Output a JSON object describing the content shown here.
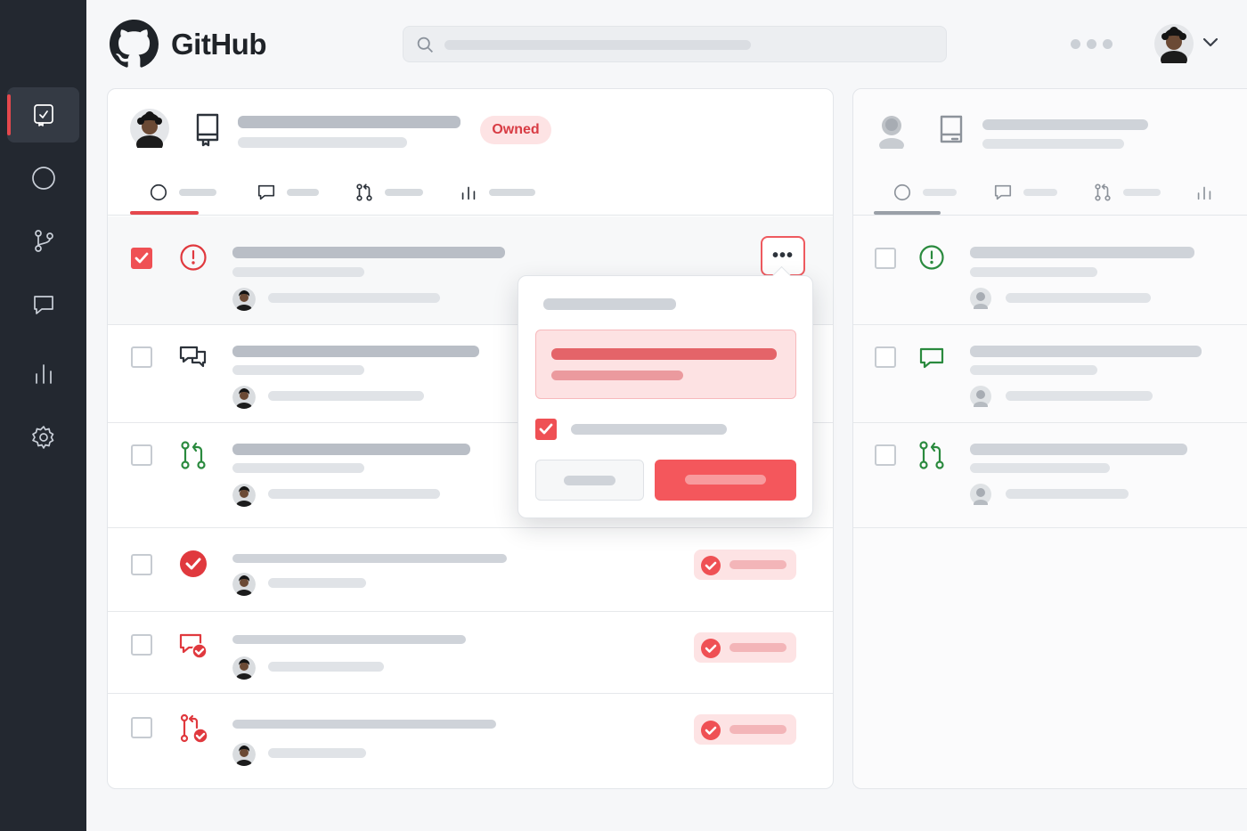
{
  "app": {
    "logo_text": "GitHub"
  },
  "colors": {
    "accent": "#ef5054",
    "sidebar_bg": "#232830",
    "success": "#2a8a3e",
    "danger": "#e5484d"
  },
  "sidebar": {
    "items": [
      {
        "icon": "repo-review-icon",
        "active": true
      },
      {
        "icon": "issue-circle-icon"
      },
      {
        "icon": "branch-icon"
      },
      {
        "icon": "comment-icon"
      },
      {
        "icon": "insights-icon"
      },
      {
        "icon": "settings-gear-icon"
      }
    ]
  },
  "header": {
    "search_icon": "search-icon",
    "more_icon": "more-dots-icon",
    "user_menu_icon": "chevron-down-icon"
  },
  "main_panel": {
    "badge": "Owned",
    "tabs": [
      {
        "icon": "issue-circle-icon",
        "active": true
      },
      {
        "icon": "comment-icon"
      },
      {
        "icon": "pull-request-icon"
      },
      {
        "icon": "insights-icon"
      }
    ],
    "rows": [
      {
        "type": "issue-open",
        "icon": "issue-alert-icon",
        "checked": true,
        "highlighted": true
      },
      {
        "type": "discussion",
        "icon": "discussion-icon",
        "checked": false
      },
      {
        "type": "pull-request",
        "icon": "pull-request-icon",
        "checked": false
      },
      {
        "type": "issue-done",
        "icon": "check-circle-icon",
        "checked": false,
        "status_badge": true
      },
      {
        "type": "discussion-done",
        "icon": "discussion-check-icon",
        "checked": false,
        "status_badge": true
      },
      {
        "type": "pull-request-done",
        "icon": "pull-request-check-icon",
        "checked": false,
        "status_badge": true
      }
    ]
  },
  "popover": {
    "more_button_label": "•••",
    "confirm_checked": true
  },
  "side_panel": {
    "tabs": [
      {
        "icon": "issue-circle-icon",
        "active": true
      },
      {
        "icon": "comment-icon"
      },
      {
        "icon": "pull-request-icon"
      },
      {
        "icon": "insights-icon"
      }
    ],
    "rows": [
      {
        "icon": "issue-alert-icon"
      },
      {
        "icon": "comment-icon"
      },
      {
        "icon": "pull-request-icon"
      }
    ]
  }
}
